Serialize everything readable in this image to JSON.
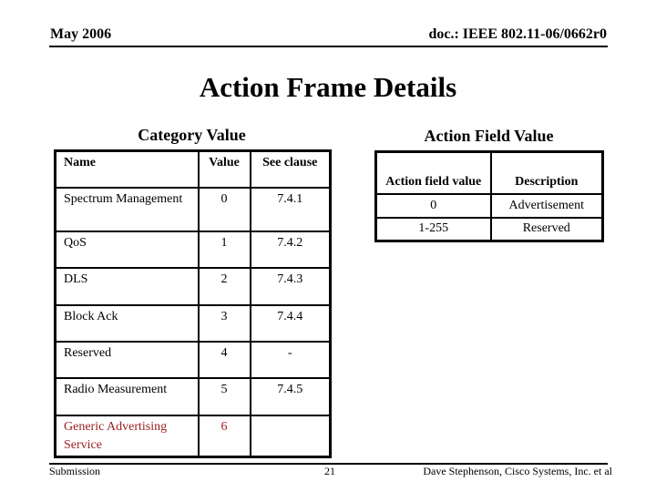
{
  "header": {
    "date": "May 2006",
    "doc_id": "doc.: IEEE 802.11-06/0662r0"
  },
  "title": "Action Frame Details",
  "category_table": {
    "title": "Category Value",
    "columns": [
      "Name",
      "Value",
      "See clause"
    ],
    "rows": [
      {
        "name": "Spectrum Management",
        "value": "0",
        "clause": "7.4.1"
      },
      {
        "name": "QoS",
        "value": "1",
        "clause": "7.4.2"
      },
      {
        "name": "DLS",
        "value": "2",
        "clause": "7.4.3"
      },
      {
        "name": "Block Ack",
        "value": "3",
        "clause": "7.4.4"
      },
      {
        "name": "Reserved",
        "value": "4",
        "clause": "-"
      },
      {
        "name": "Radio Measurement",
        "value": "5",
        "clause": "7.4.5"
      },
      {
        "name": "Generic Advertising Service",
        "value": "6",
        "clause": ""
      }
    ],
    "highlight_color": "#9b1c1f"
  },
  "action_table": {
    "title": "Action Field Value",
    "columns": [
      "Action field value",
      "Description"
    ],
    "rows": [
      {
        "value": "0",
        "description": "Advertisement"
      },
      {
        "value": "1-255",
        "description": "Reserved"
      }
    ]
  },
  "footer": {
    "left": "Submission",
    "page": "21",
    "right": "Dave Stephenson, Cisco Systems, Inc. et al"
  }
}
